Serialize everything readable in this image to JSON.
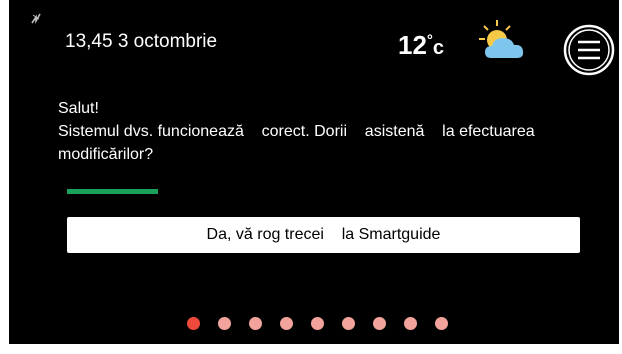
{
  "status_bar": {
    "datetime": "13,45 3 octombrie",
    "temperature": "12",
    "degree_symbol": "°",
    "temperature_unit": "c",
    "weather_icon": "partly-cloudy-icon",
    "signal_icon": "signal-icon",
    "menu_icon": "hamburger-menu-icon"
  },
  "message": {
    "greeting": "Salut!",
    "body": "Sistemul dvs. funcionează    corect. Dorii    asistenă    la efectuarea modificărilor?"
  },
  "progress": {
    "fraction": 0.15,
    "color": "#1aa15a"
  },
  "smartguide_button": {
    "label": "Da, vă rog trecei    la Smartguide"
  },
  "pagination": {
    "total": 9,
    "active_index": 0,
    "active_color": "#ee4a3c",
    "inactive_color": "#f2a39b"
  }
}
